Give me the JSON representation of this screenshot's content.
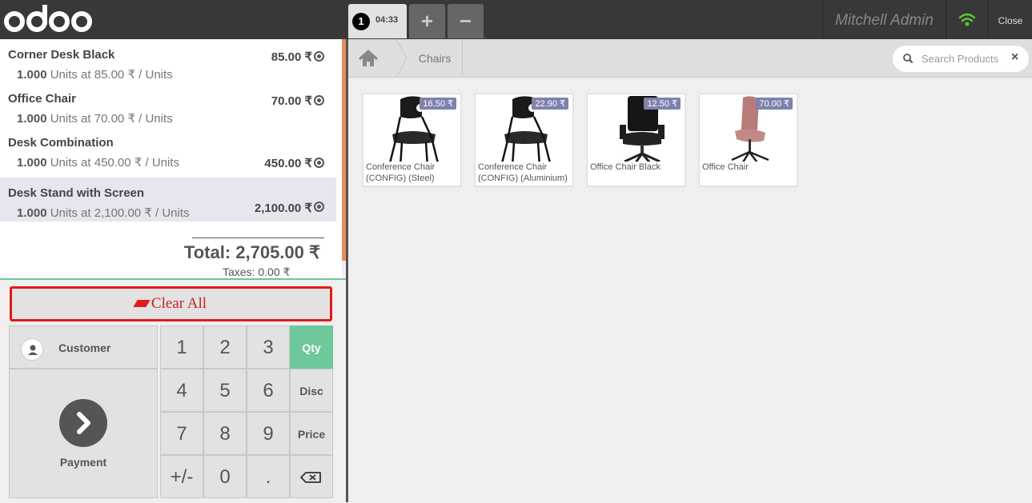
{
  "header": {
    "order_number": "1",
    "order_time": "04:33",
    "add_label": "+",
    "remove_label": "−",
    "user_name": "Mitchell Admin",
    "close_label": "Close"
  },
  "order": {
    "lines": [
      {
        "name": "Corner Desk Black",
        "price": "85.00 ₹",
        "qty": "1.000",
        "detail": "Units at 85.00 ₹ / Units"
      },
      {
        "name": "Office Chair",
        "price": "70.00 ₹",
        "qty": "1.000",
        "detail": "Units at 70.00 ₹ / Units"
      },
      {
        "name": "Desk Combination",
        "price": "450.00 ₹",
        "qty": "1.000",
        "detail": "Units at 450.00 ₹ / Units"
      },
      {
        "name": "Desk Stand with Screen",
        "price": "2,100.00 ₹",
        "qty": "1.000",
        "detail": "Units at 2,100.00 ₹ / Units"
      }
    ],
    "total": "Total: 2,705.00 ₹",
    "taxes": "Taxes: 0.00 ₹"
  },
  "clear_all_label": "Clear All",
  "numpad": {
    "customer_label": "Customer",
    "payment_label": "Payment",
    "keys": [
      "1",
      "2",
      "3",
      "4",
      "5",
      "6",
      "7",
      "8",
      "9",
      "+/-",
      "0",
      "."
    ],
    "modes": {
      "qty": "Qty",
      "disc": "Disc",
      "price": "Price"
    }
  },
  "breadcrumb": {
    "category": "Chairs"
  },
  "search": {
    "placeholder": "Search Products"
  },
  "products": [
    {
      "name": "Conference Chair (CONFIG) (Steel)",
      "price": "16.50 ₹"
    },
    {
      "name": "Conference Chair (CONFIG) (Aluminium)",
      "price": "22.90 ₹"
    },
    {
      "name": "Office Chair Black",
      "price": "12.50 ₹"
    },
    {
      "name": "Office Chair",
      "price": "70.00 ₹"
    }
  ],
  "colors": {
    "accent": "#6ec89b",
    "danger": "#e01c1c",
    "header": "#383838",
    "price_tag": "#7f82ac"
  },
  "icons": {
    "home": "home-icon",
    "search": "search-icon",
    "wifi": "wifi-icon",
    "user": "user-icon",
    "payment": "chevron-right-icon",
    "backspace": "backspace-icon"
  }
}
